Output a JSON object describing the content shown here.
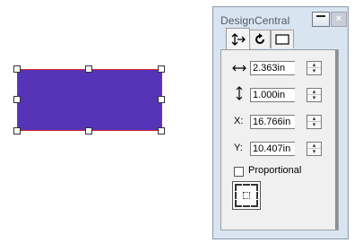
{
  "canvas": {
    "shape_fill": "#5634b8",
    "shape_stroke": "#d4262c"
  },
  "palette": {
    "title": "DesignCentral",
    "tabs": [
      {
        "icon": "move-resize-icon"
      },
      {
        "icon": "rotate-icon"
      },
      {
        "icon": "frame-icon"
      }
    ],
    "fields": {
      "width": {
        "icon": "horizontal-arrow-icon",
        "value": "2.363in"
      },
      "height": {
        "icon": "vertical-arrow-icon",
        "value": "1.000in"
      },
      "x": {
        "label": "X:",
        "value": "16.766in"
      },
      "y": {
        "label": "Y:",
        "value": "10.407in"
      }
    },
    "proportional": {
      "label": "Proportional",
      "checked": false
    },
    "anchor": {
      "icon": "anchor-grid-icon"
    }
  }
}
